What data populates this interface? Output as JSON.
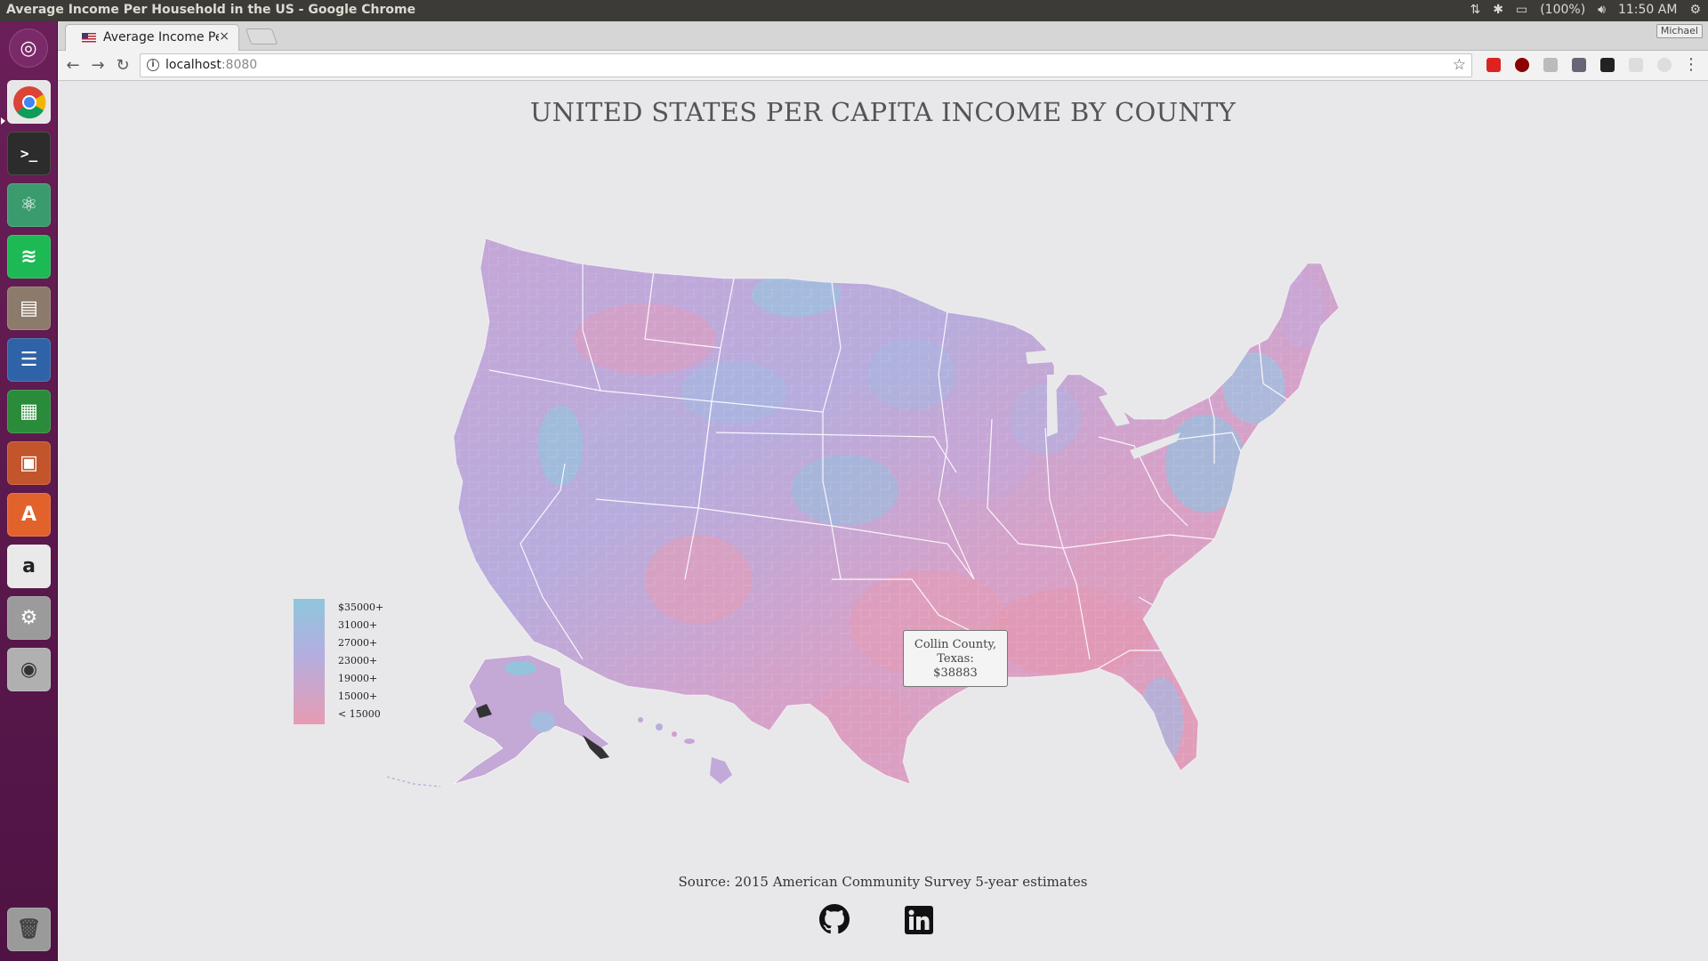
{
  "window": {
    "title": "Average Income Per Household in the US - Google Chrome"
  },
  "panel": {
    "battery": "(100%)",
    "clock": "11:50 AM"
  },
  "launcher": {
    "items": [
      "ubuntu-dash",
      "chrome",
      "terminal",
      "atom",
      "spotify",
      "files",
      "writer",
      "calc",
      "impress",
      "software-center",
      "amazon",
      "system-settings",
      "screenshot",
      "trash"
    ]
  },
  "browser": {
    "tab_title": "Average Income Pe",
    "tab_close": "×",
    "profile_name": "Michael",
    "url_host": "localhost",
    "url_port": ":8080"
  },
  "page": {
    "title": "UNITED STATES PER CAPITA INCOME BY COUNTY",
    "source": "Source: 2015 American Community Survey 5-year estimates"
  },
  "legend": {
    "labels": [
      "$35000+",
      "31000+",
      "27000+",
      "23000+",
      "19000+",
      "15000+",
      "< 15000"
    ],
    "colors": {
      "high": "#8fc6dc",
      "mid": "#b4aee0",
      "low": "#e79bb2"
    }
  },
  "tooltip": {
    "line1": "Collin County,",
    "line2": "Texas:",
    "line3": "$38883"
  }
}
